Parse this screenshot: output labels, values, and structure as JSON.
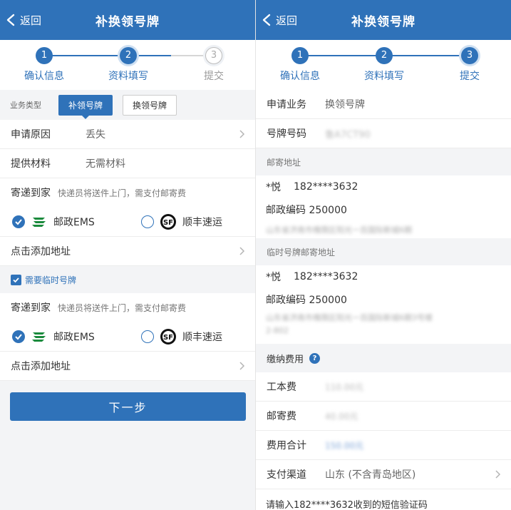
{
  "left": {
    "header": {
      "back": "返回",
      "title": "补换领号牌"
    },
    "steps": [
      {
        "num": "1",
        "label": "确认信息"
      },
      {
        "num": "2",
        "label": "资料填写"
      },
      {
        "num": "3",
        "label": "提交"
      }
    ],
    "business_type": {
      "label": "业务类型",
      "selected": "补领号牌",
      "other": "换领号牌"
    },
    "reason": {
      "label": "申请原因",
      "value": "丢失"
    },
    "materials": {
      "label": "提供材料",
      "value": "无需材料"
    },
    "delivery1": {
      "label": "寄递到家",
      "hint": "快递员将送件上门，需支付邮寄费",
      "ems": "邮政EMS",
      "sf": "顺丰速运",
      "add_address": "点击添加地址"
    },
    "temp_plate": {
      "label": "需要临时号牌"
    },
    "delivery2": {
      "label": "寄递到家",
      "hint": "快递员将送件上门，需支付邮寄费",
      "ems": "邮政EMS",
      "sf": "顺丰速运",
      "add_address": "点击添加地址"
    },
    "next_button": "下一步"
  },
  "right": {
    "header": {
      "back": "返回",
      "title": "补换领号牌"
    },
    "steps": [
      {
        "num": "1",
        "label": "确认信息"
      },
      {
        "num": "2",
        "label": "资料填写"
      },
      {
        "num": "3",
        "label": "提交"
      }
    ],
    "apply_business": {
      "label": "申请业务",
      "value": "换领号牌"
    },
    "plate_number": {
      "label": "号牌号码",
      "value": "鲁A7CT90"
    },
    "mail_address": {
      "title": "邮寄地址",
      "name": "*悦",
      "phone": "182****3632",
      "postcode": "邮政编码 250000",
      "address": "山东省济南市槐荫区阳光一百国际新城6期"
    },
    "temp_mail_address": {
      "title": "临时号牌邮寄地址",
      "name": "*悦",
      "phone": "182****3632",
      "postcode": "邮政编码 250000",
      "address": "山东省济南市槐荫区阳光一百国际新城6期3号楼",
      "address2": "2-802"
    },
    "fees": {
      "title": "缴纳费用",
      "help": "?",
      "cost": {
        "label": "工本费",
        "value": "110.00元"
      },
      "postage": {
        "label": "邮寄费",
        "value": "40.00元"
      },
      "total": {
        "label": "费用合计",
        "value": "150.00元"
      }
    },
    "payment": {
      "label": "支付渠道",
      "value": "山东 (不含青岛地区)"
    },
    "sms_prompt": "请输入182****3632收到的短信验证码"
  },
  "colors": {
    "primary": "#2f72b9",
    "background": "#f3f4f6"
  }
}
